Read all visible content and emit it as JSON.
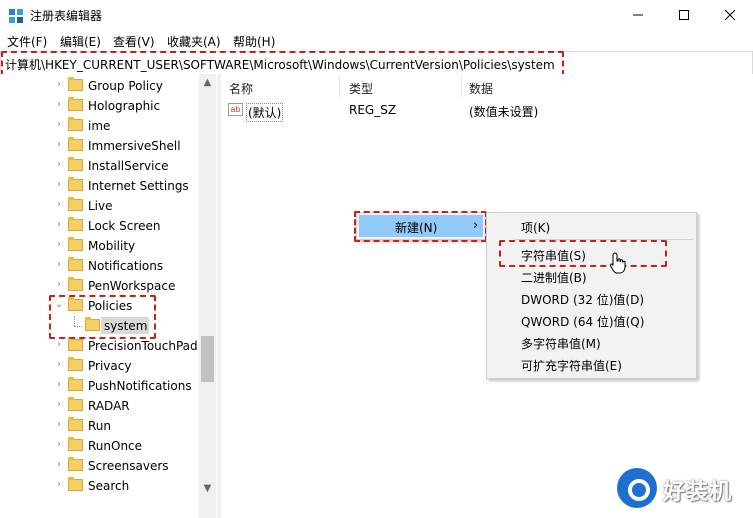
{
  "window": {
    "title": "注册表编辑器"
  },
  "menu": [
    "文件(F)",
    "编辑(E)",
    "查看(V)",
    "收藏夹(A)",
    "帮助(H)"
  ],
  "address": "计算机\\HKEY_CURRENT_USER\\SOFTWARE\\Microsoft\\Windows\\CurrentVersion\\Policies\\system",
  "tree": [
    {
      "label": "Group Policy",
      "expanded": false
    },
    {
      "label": "Holographic",
      "expanded": false
    },
    {
      "label": "ime",
      "expanded": false
    },
    {
      "label": "ImmersiveShell",
      "expanded": false
    },
    {
      "label": "InstallService",
      "expanded": false
    },
    {
      "label": "Internet Settings",
      "expanded": false
    },
    {
      "label": "Live",
      "expanded": false
    },
    {
      "label": "Lock Screen",
      "expanded": false
    },
    {
      "label": "Mobility",
      "expanded": false
    },
    {
      "label": "Notifications",
      "expanded": false
    },
    {
      "label": "PenWorkspace",
      "expanded": false
    },
    {
      "label": "Policies",
      "expanded": true
    },
    {
      "label": "system",
      "child": true,
      "selected": true
    },
    {
      "label": "PrecisionTouchPad",
      "expanded": false
    },
    {
      "label": "Privacy",
      "expanded": false
    },
    {
      "label": "PushNotifications",
      "expanded": false
    },
    {
      "label": "RADAR",
      "expanded": false
    },
    {
      "label": "Run",
      "expanded": false
    },
    {
      "label": "RunOnce",
      "expanded": false
    },
    {
      "label": "Screensavers",
      "expanded": false
    },
    {
      "label": "Search",
      "expanded": false
    }
  ],
  "list": {
    "headers": {
      "name": "名称",
      "type": "类型",
      "data": "数据"
    },
    "rows": [
      {
        "icon": "ab",
        "name": "(默认)",
        "type": "REG_SZ",
        "data": "(数值未设置)"
      }
    ]
  },
  "context_menu": {
    "new_label": "新建(N)",
    "arrow": "›"
  },
  "submenu": [
    "项(K)",
    "字符串值(S)",
    "二进制值(B)",
    "DWORD (32 位)值(D)",
    "QWORD (64 位)值(Q)",
    "多字符串值(M)",
    "可扩充字符串值(E)"
  ],
  "watermark": {
    "text": "好装机"
  },
  "colors": {
    "highlight_dash": "#c8201b",
    "menu_hover": "#91c9f7",
    "folder": "#f5cf63"
  }
}
